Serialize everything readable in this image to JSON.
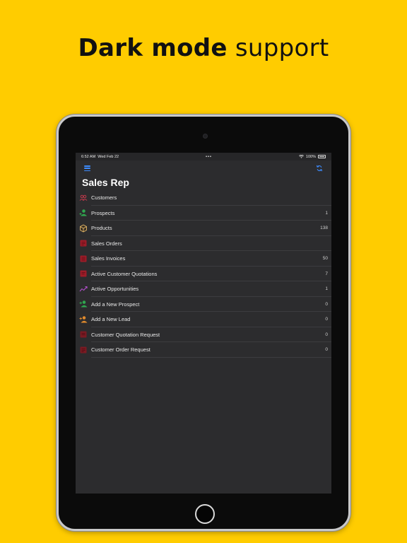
{
  "headline": {
    "bold": "Dark mode",
    "light": "support"
  },
  "status_bar": {
    "time": "6:52 AM",
    "date": "Wed Feb 22",
    "dots": "•••",
    "battery": "100%"
  },
  "nav": {
    "title": "Sales Rep"
  },
  "icons": {
    "menu": "hamburger-menu-icon",
    "refresh": "refresh-icon"
  },
  "colors": {
    "background": "#FFCC00",
    "screen": "#2C2C2E",
    "accent": "#3D8BFD"
  },
  "menu_items": [
    {
      "label": "Customers",
      "count": "",
      "icon": "customers-icon",
      "color": "#c0394b"
    },
    {
      "label": "Prospects",
      "count": "1",
      "icon": "prospect-person-icon",
      "color": "#2fa84f"
    },
    {
      "label": "Products",
      "count": "138",
      "icon": "product-box-icon",
      "color": "#e5b968"
    },
    {
      "label": "Sales Orders",
      "count": "",
      "icon": "sales-order-icon",
      "color": "#9c1c28"
    },
    {
      "label": "Sales Invoices",
      "count": "50",
      "icon": "sales-invoice-icon",
      "color": "#9c1c28"
    },
    {
      "label": "Active Customer Quotations",
      "count": "7",
      "icon": "quotation-icon",
      "color": "#9c1c28"
    },
    {
      "label": "Active Opportunities",
      "count": "1",
      "icon": "trend-chart-icon",
      "color": "#b04fc9"
    },
    {
      "label": "Add a New Prospect",
      "count": "0",
      "icon": "add-prospect-icon",
      "color": "#2fa84f"
    },
    {
      "label": "Add a New Lead",
      "count": "0",
      "icon": "add-lead-icon",
      "color": "#e08a2c"
    },
    {
      "label": "Customer Quotation Request",
      "count": "0",
      "icon": "quotation-request-icon",
      "color": "#7a1a22"
    },
    {
      "label": "Customer Order Request",
      "count": "0",
      "icon": "order-request-icon",
      "color": "#7a1a22"
    }
  ]
}
